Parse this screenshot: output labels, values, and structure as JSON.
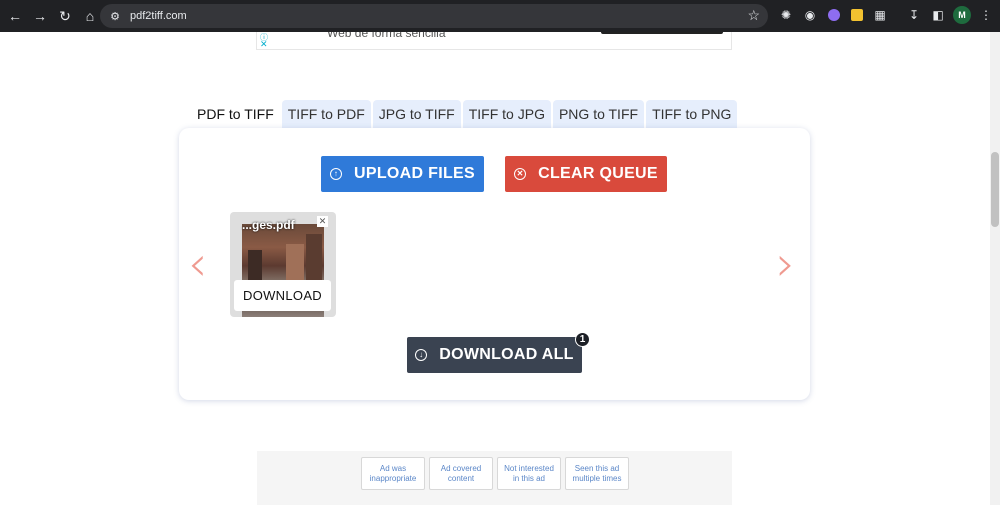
{
  "browser": {
    "url": "pdf2tiff.com",
    "avatar_letter": "M"
  },
  "tabs": [
    {
      "label": "PDF to TIFF",
      "active": true
    },
    {
      "label": "TIFF to PDF",
      "active": false
    },
    {
      "label": "JPG to TIFF",
      "active": false
    },
    {
      "label": "TIFF to JPG",
      "active": false
    },
    {
      "label": "PNG to TIFF",
      "active": false
    },
    {
      "label": "TIFF to PNG",
      "active": false
    }
  ],
  "actions": {
    "upload_label": "UPLOAD FILES",
    "clear_label": "CLEAR QUEUE",
    "download_all_label": "DOWNLOAD ALL",
    "download_count": "1"
  },
  "file": {
    "name": "...ges.pdf",
    "download_label": "DOWNLOAD"
  },
  "ad_feedback": [
    "Ad was inappropriate",
    "Ad covered content",
    "Not interested in this ad",
    "Seen this ad multiple times"
  ],
  "top_ad_text": "Web de forma sencilla",
  "colors": {
    "upload": "#2f7ad9",
    "clear": "#d94a3c",
    "download_all": "#3a4351",
    "tab_bg": "#e6eefc",
    "arrows": "#ef9a90"
  }
}
